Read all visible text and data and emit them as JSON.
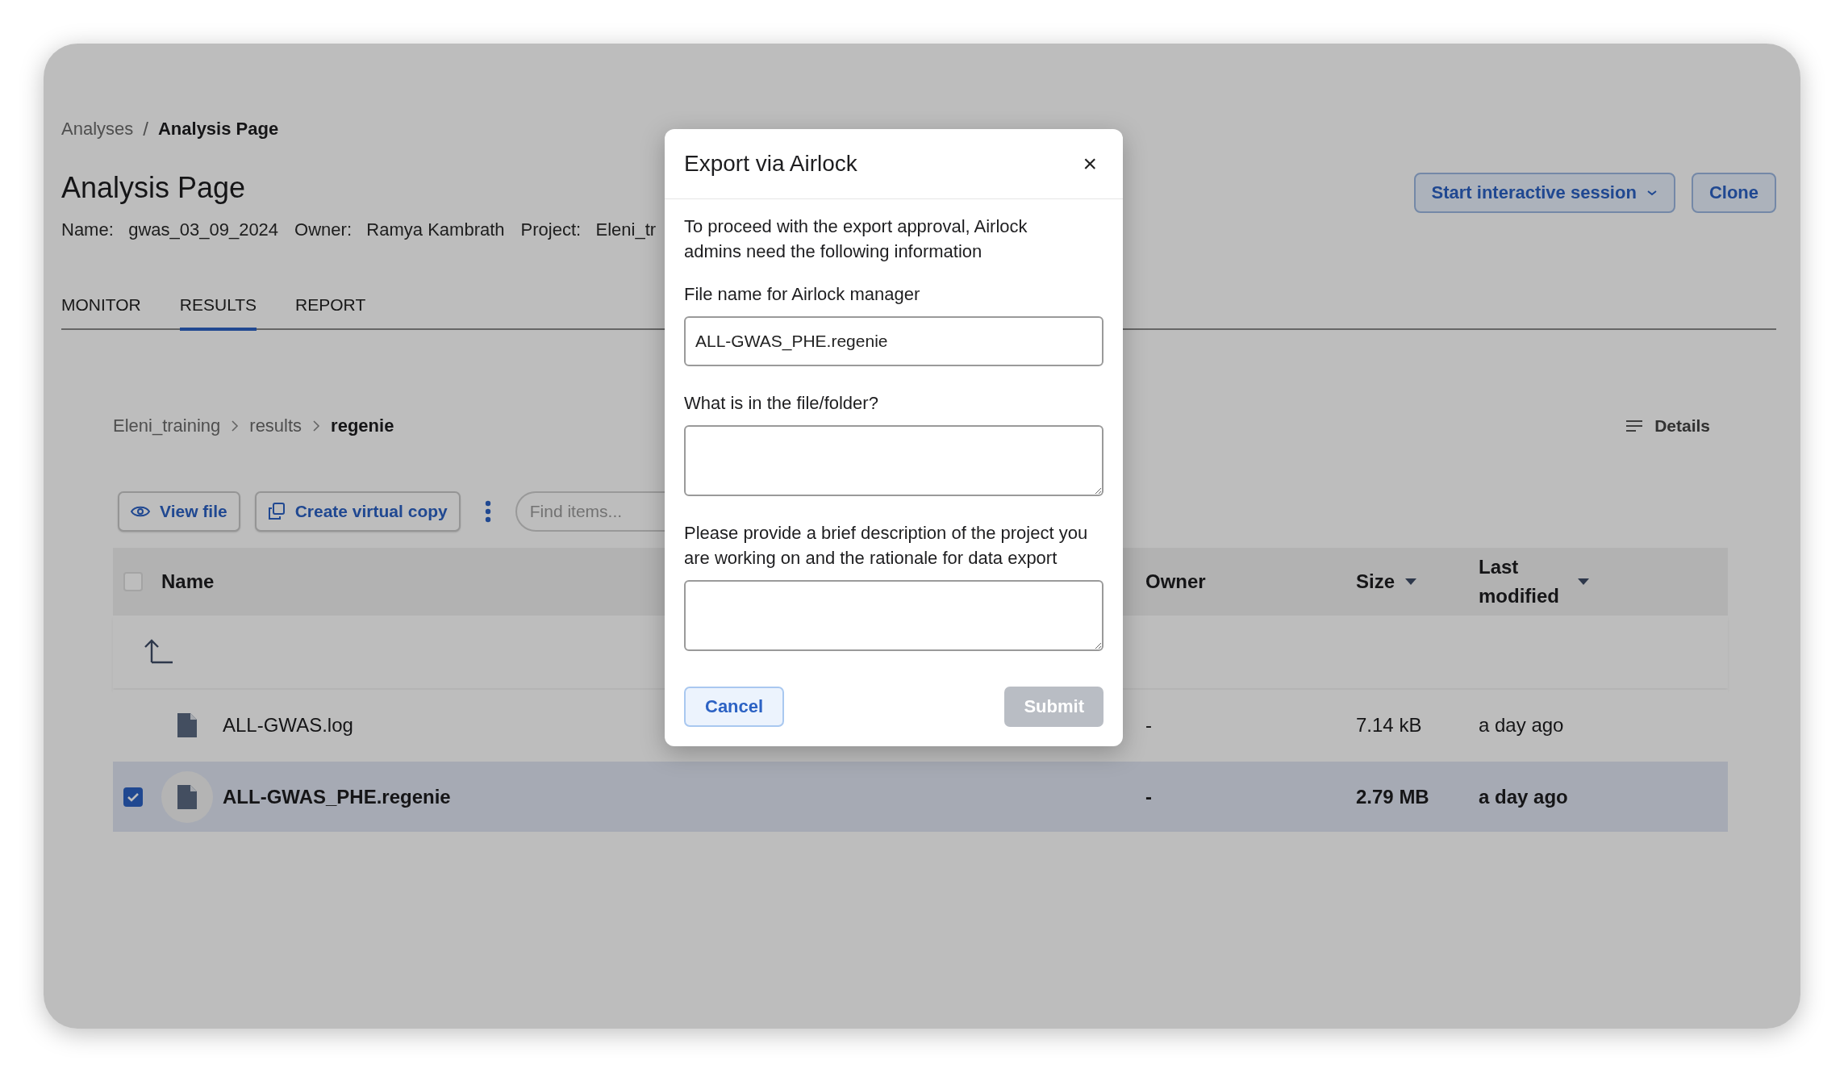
{
  "breadcrumb_separator": "/",
  "breadcrumb": [
    {
      "label": "Analyses",
      "current": false
    },
    {
      "label": "Analysis Page",
      "current": true
    }
  ],
  "page_title": "Analysis Page",
  "meta": [
    {
      "label": "Name:",
      "value": "gwas_03_09_2024"
    },
    {
      "label": "Owner:",
      "value": "Ramya Kambrath"
    },
    {
      "label": "Project:",
      "value": "Eleni_tr"
    }
  ],
  "actions": [
    {
      "label": "Start interactive session",
      "kind": "dropdown"
    },
    {
      "label": "Clone",
      "kind": "plain"
    }
  ],
  "tabs": [
    {
      "label": "MONITOR",
      "selected": false
    },
    {
      "label": "RESULTS",
      "selected": true
    },
    {
      "label": "REPORT",
      "selected": false
    }
  ],
  "folder_path": [
    {
      "label": "Eleni_training",
      "current": false
    },
    {
      "label": "results",
      "current": false
    },
    {
      "label": "regenie",
      "current": true
    }
  ],
  "details_button": "Details",
  "toolbar": {
    "buttons": [
      {
        "label": "View file",
        "kind": "view"
      },
      {
        "label": "Create virtual copy",
        "kind": "copy"
      }
    ],
    "search": {
      "placeholder": "Find items..."
    }
  },
  "table": {
    "header_checked": false,
    "columns": [
      {
        "label": "Name",
        "sorted": false
      },
      {
        "label": "Owner",
        "sorted": false
      },
      {
        "label": "Size",
        "sorted": true
      },
      {
        "label": "Last modified",
        "sorted": true
      }
    ],
    "rows": [
      {
        "name": "ALL-GWAS.log",
        "owner": "-",
        "size": "7.14 kB",
        "modified": "a day ago",
        "selected": false
      },
      {
        "name": "ALL-GWAS_PHE.regenie",
        "owner": "-",
        "size": "2.79 MB",
        "modified": "a day ago",
        "selected": true
      }
    ]
  },
  "dialog": {
    "title": "Export via Airlock",
    "close": "×",
    "intro": "To proceed with the export approval, Airlock admins need the following information",
    "fields": [
      {
        "label": "File name for Airlock manager",
        "kind": "input",
        "value": "ALL-GWAS_PHE.regenie"
      },
      {
        "label": "What is in the file/folder?",
        "kind": "textarea"
      },
      {
        "label": "Please provide a brief description of the project you are working on and the rationale for data export",
        "kind": "textarea"
      }
    ],
    "cancel": "Cancel",
    "submit": {
      "label": "Submit",
      "disabled": true
    }
  }
}
